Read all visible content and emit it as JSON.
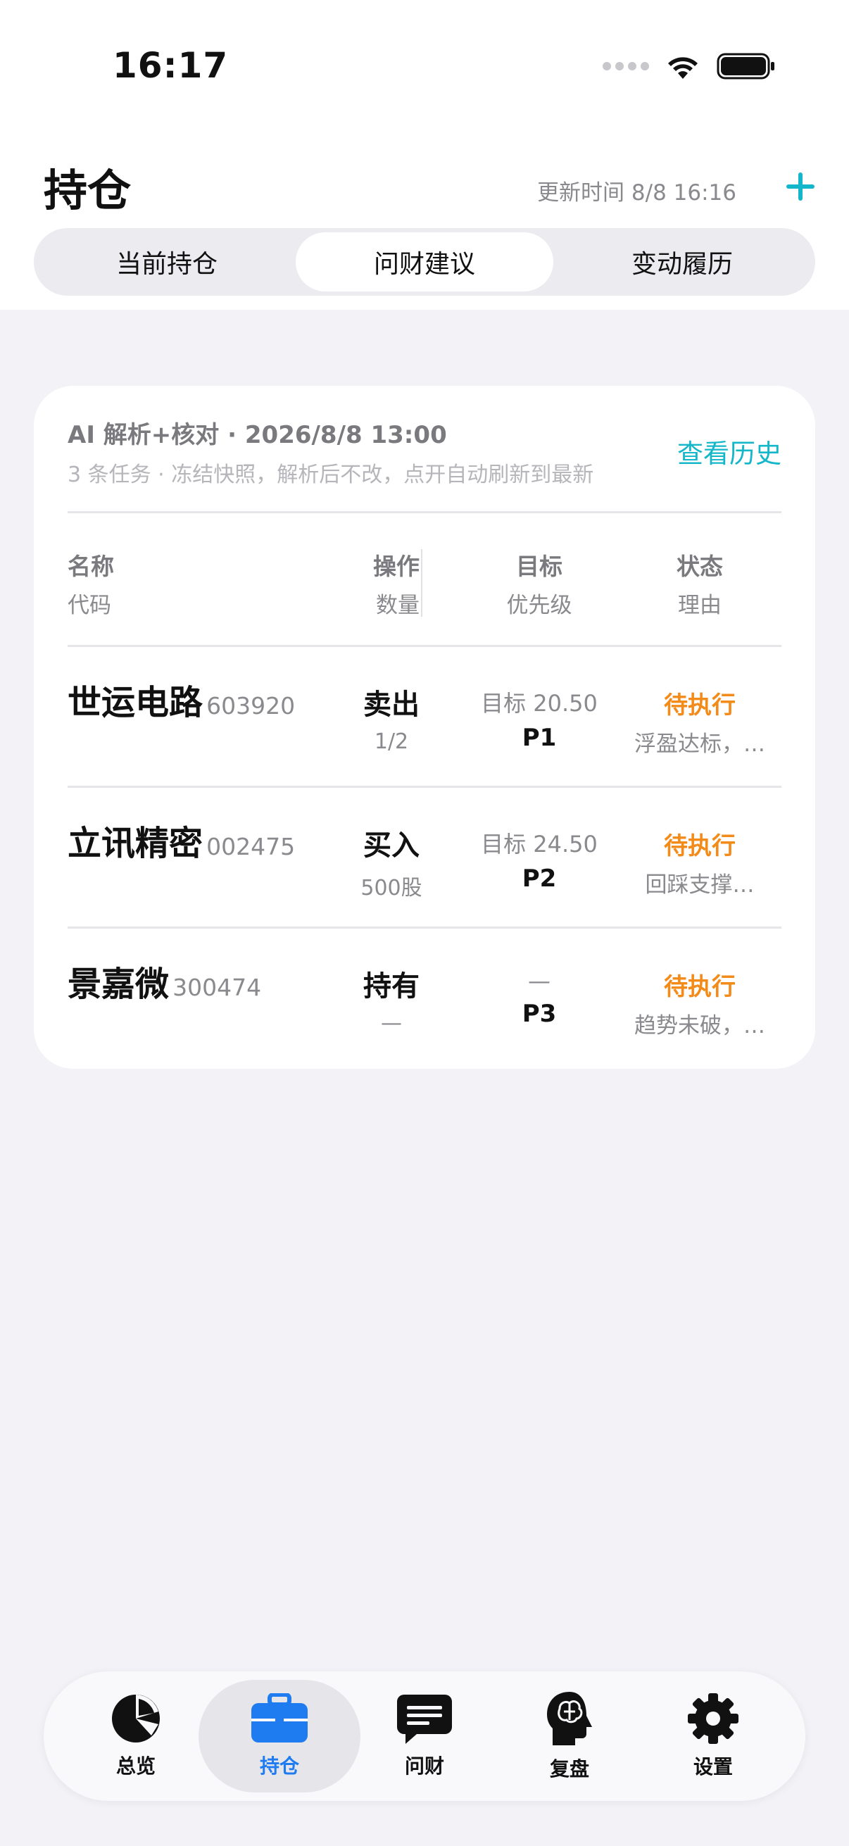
{
  "status_bar": {
    "time": "16:17"
  },
  "header": {
    "title": "持仓",
    "update_time": "更新时间 8/8 16:16",
    "add_icon": "plus-icon",
    "accent_color": "#13b7c9"
  },
  "tabs": [
    {
      "label": "当前持仓",
      "active": false
    },
    {
      "label": "问财建议",
      "active": true
    },
    {
      "label": "变动履历",
      "active": false
    }
  ],
  "card": {
    "title": "AI 解析+核对 · 2026/8/8 13:00",
    "subtitle": "3 条任务 · 冻结快照，解析后不改，点开自动刷新到最新",
    "history_link": "查看历史",
    "columns": {
      "name": "名称",
      "code": "代码",
      "action": "操作",
      "quantity": "数量",
      "target": "目标",
      "priority": "优先级",
      "status": "状态",
      "reason": "理由"
    },
    "rows": [
      {
        "name": "世运电路",
        "code": "603920",
        "action": "卖出",
        "quantity": "1/2",
        "target": "目标 20.50",
        "priority": "P1",
        "status": "待执行",
        "reason": "浮盈达标，…"
      },
      {
        "name": "立讯精密",
        "code": "002475",
        "action": "买入",
        "quantity": "500股",
        "target": "目标 24.50",
        "priority": "P2",
        "status": "待执行",
        "reason": "回踩支撑…"
      },
      {
        "name": "景嘉微",
        "code": "300474",
        "action": "持有",
        "quantity": "—",
        "target": "—",
        "priority": "P3",
        "status": "待执行",
        "reason": "趋势未破，…"
      }
    ],
    "status_color": "#f28b1a"
  },
  "tabbar": [
    {
      "label": "总览",
      "icon": "pie-chart-icon",
      "active": false
    },
    {
      "label": "持仓",
      "icon": "briefcase-icon",
      "active": true
    },
    {
      "label": "问财",
      "icon": "chat-bubble-icon",
      "active": false
    },
    {
      "label": "复盘",
      "icon": "brain-head-icon",
      "active": false
    },
    {
      "label": "设置",
      "icon": "gear-icon",
      "active": false
    }
  ],
  "tabbar_active_color": "#1e7cf0"
}
